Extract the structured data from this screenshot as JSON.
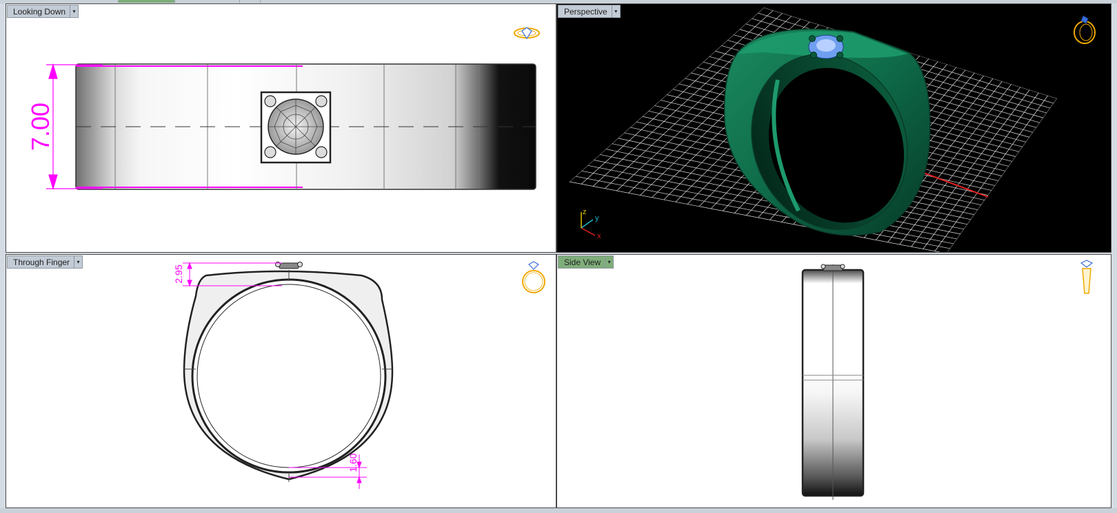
{
  "viewports": {
    "top_left": {
      "label": "Looking Down",
      "dimension": "7.00"
    },
    "top_right": {
      "label": "Perspective",
      "axes": {
        "x": "x",
        "y": "y",
        "z": "z"
      }
    },
    "bottom_left": {
      "label": "Through Finger",
      "dimension_top": "2.95",
      "dimension_bottom": "1.60"
    },
    "bottom_right": {
      "label": "Side View"
    }
  },
  "dropdown_glyph": "▾",
  "colors": {
    "dimension": "#ff00ff",
    "ring_green": "#0f6b4b",
    "gem_blue": "#6f9ff0",
    "grid": "#e6e6e6",
    "icon_gold": "#f0a800"
  }
}
